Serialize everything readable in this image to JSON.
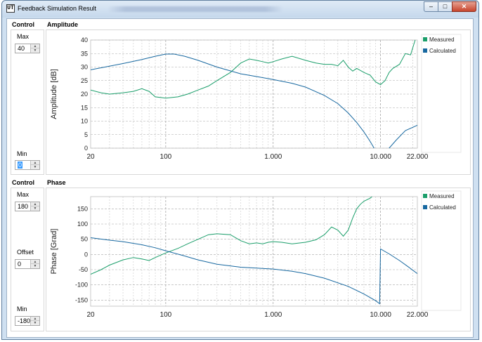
{
  "window": {
    "title": "Feedback Simulation Result",
    "icon": "app-logo-icon",
    "controls": {
      "minimize": "–",
      "maximize": "□",
      "close": "✕"
    }
  },
  "amplitude": {
    "control_title": "Control",
    "max_label": "Max",
    "max_value": "40",
    "min_label": "Min",
    "min_value": "0",
    "chart_title": "Amplitude"
  },
  "phase": {
    "control_title": "Control",
    "max_label": "Max",
    "max_value": "180",
    "offset_label": "Offset",
    "offset_value": "0",
    "min_label": "Min",
    "min_value": "-180",
    "chart_title": "Phase"
  },
  "colors": {
    "measured": "#1a9e6a",
    "calculated": "#1768a0"
  },
  "chart_data": [
    {
      "type": "line",
      "ylabel": "Amplitude [dB]",
      "xscale": "log",
      "xlim": [
        20,
        22000
      ],
      "ylim": [
        0,
        40
      ],
      "grid": true,
      "legend_position": "right",
      "x_tick_labels": [
        "20",
        "100",
        "1.000",
        "10.000",
        "22.000"
      ],
      "x_tick_values": [
        20,
        100,
        1000,
        10000,
        22000
      ],
      "y_ticks": [
        0,
        5,
        10,
        15,
        20,
        25,
        30,
        35,
        40
      ],
      "series": [
        {
          "name": "Measured",
          "x": [
            20,
            25,
            30,
            40,
            50,
            60,
            70,
            80,
            100,
            130,
            160,
            200,
            250,
            300,
            400,
            500,
            600,
            700,
            800,
            900,
            1000,
            1200,
            1500,
            2000,
            2500,
            3000,
            3500,
            4000,
            4500,
            5000,
            5500,
            6000,
            7000,
            8000,
            9000,
            10000,
            11000,
            12000,
            13000,
            15000,
            17000,
            19000,
            21000
          ],
          "y": [
            21.5,
            20.5,
            20,
            20.5,
            21,
            22,
            21,
            19,
            18.5,
            19,
            20,
            21.5,
            23,
            25,
            28,
            31.5,
            33,
            32.5,
            32,
            31.5,
            32,
            33,
            34,
            32.5,
            31.5,
            31,
            31,
            30.5,
            32.5,
            30,
            28.5,
            29.5,
            28,
            27,
            24.5,
            23.5,
            25,
            28,
            29.5,
            31,
            35,
            34.5,
            40
          ]
        },
        {
          "name": "Calculated",
          "x": [
            20,
            40,
            60,
            80,
            100,
            120,
            150,
            200,
            300,
            500,
            700,
            1000,
            1500,
            2000,
            3000,
            4000,
            5000,
            6000,
            7000,
            8000,
            9000,
            9500,
            10000,
            11000,
            12000,
            14000,
            17000,
            22000
          ],
          "y": [
            29,
            31.3,
            32.8,
            34,
            34.8,
            34.8,
            34,
            32.5,
            30,
            27.5,
            26.5,
            25.4,
            24,
            22.6,
            19.5,
            16.5,
            13,
            9.5,
            6,
            2.5,
            -1,
            -3,
            -5,
            -1.5,
            0,
            3,
            6.5,
            8.5
          ]
        }
      ]
    },
    {
      "type": "line",
      "ylabel": "Phase [Grad]",
      "xscale": "log",
      "xlim": [
        20,
        22000
      ],
      "ylim": [
        -170,
        190
      ],
      "grid": true,
      "legend_position": "right",
      "x_tick_labels": [
        "20",
        "100",
        "1.000",
        "10.000",
        "22.000"
      ],
      "x_tick_values": [
        20,
        100,
        1000,
        10000,
        22000
      ],
      "y_ticks": [
        -150,
        -100,
        -50,
        0,
        50,
        100,
        150
      ],
      "series": [
        {
          "name": "Measured",
          "x": [
            20,
            25,
            30,
            40,
            50,
            60,
            70,
            80,
            100,
            130,
            160,
            200,
            250,
            300,
            400,
            500,
            600,
            700,
            800,
            900,
            1000,
            1200,
            1500,
            2000,
            2500,
            3000,
            3500,
            4000,
            4500,
            5000,
            5500,
            6000,
            6500,
            7000,
            8000,
            9000
          ],
          "y": [
            -65,
            -50,
            -35,
            -18,
            -10,
            -15,
            -20,
            -10,
            5,
            20,
            35,
            50,
            65,
            68,
            65,
            45,
            35,
            38,
            35,
            40,
            42,
            40,
            35,
            40,
            48,
            65,
            90,
            80,
            60,
            80,
            120,
            150,
            165,
            175,
            185,
            200
          ]
        },
        {
          "name": "Calculated",
          "x": [
            20,
            30,
            40,
            60,
            80,
            100,
            150,
            200,
            300,
            500,
            700,
            1000,
            1500,
            2000,
            3000,
            5000,
            7000,
            9000,
            9800,
            10000,
            12000,
            15000,
            18000,
            22000
          ],
          "y": [
            55,
            47,
            42,
            32,
            22,
            12,
            -5,
            -18,
            -32,
            -42,
            -45,
            -48,
            -55,
            -63,
            -78,
            -105,
            -130,
            -152,
            -162,
            18,
            2,
            -20,
            -40,
            -63
          ]
        }
      ]
    }
  ]
}
